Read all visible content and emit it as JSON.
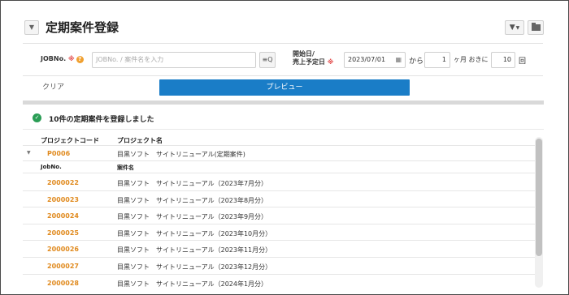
{
  "header": {
    "title": "定期案件登録",
    "toggle_icon": "▼",
    "filter_icon": "▼"
  },
  "form": {
    "jobno_label": "JOBNo.",
    "required_mark": "※",
    "jobno_placeholder": "JOBNo. / 案件名を入力",
    "search_btn": "≡Q",
    "date_label_1": "開始日/",
    "date_label_2": "売上予定日",
    "date_value": "2023/07/01",
    "from_text": "から",
    "months_value": "1",
    "months_suffix": "ヶ月 おきに",
    "count_value": "10",
    "count_suffix": "回"
  },
  "actions": {
    "clear": "クリア",
    "preview": "プレビュー"
  },
  "message": {
    "text": "10件の定期案件を登録しました"
  },
  "table": {
    "col_project_code": "プロジェクトコード",
    "col_project_name": "プロジェクト名",
    "project": {
      "code": "P0006",
      "name": "目黒ソフト　サイトリニューアル(定期案件)"
    },
    "sub_col_jobno": "JobNo.",
    "sub_col_name": "案件名",
    "rows": [
      {
        "jobno": "2000022",
        "name": "目黒ソフト　サイトリニューアル（2023年7月分）"
      },
      {
        "jobno": "2000023",
        "name": "目黒ソフト　サイトリニューアル（2023年8月分）"
      },
      {
        "jobno": "2000024",
        "name": "目黒ソフト　サイトリニューアル（2023年9月分）"
      },
      {
        "jobno": "2000025",
        "name": "目黒ソフト　サイトリニューアル（2023年10月分）"
      },
      {
        "jobno": "2000026",
        "name": "目黒ソフト　サイトリニューアル（2023年11月分）"
      },
      {
        "jobno": "2000027",
        "name": "目黒ソフト　サイトリニューアル（2023年12月分）"
      },
      {
        "jobno": "2000028",
        "name": "目黒ソフト　サイトリニューアル（2024年1月分）"
      }
    ]
  },
  "colors": {
    "accent": "#1a7dc7",
    "orange": "#e08a1e",
    "success": "#2a9d55",
    "required": "#e24a4a"
  }
}
